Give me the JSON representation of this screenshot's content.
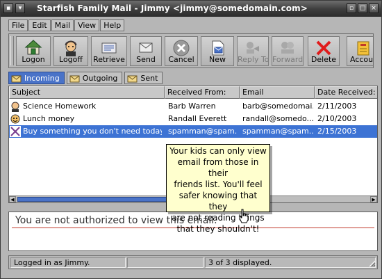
{
  "window": {
    "title": "Starfish Family Mail - Jimmy <jimmy@somedomain.com>"
  },
  "menu": [
    "File",
    "Edit",
    "Mail",
    "View",
    "Help"
  ],
  "toolbar": {
    "buttons": [
      {
        "label": "Logon",
        "icon": "house-icon",
        "enabled": true
      },
      {
        "label": "Logoff",
        "icon": "user-avatar-icon",
        "enabled": true
      },
      {
        "label": "Retrieve",
        "icon": "retrieve-mail-icon",
        "enabled": true
      },
      {
        "label": "Send",
        "icon": "send-mail-icon",
        "enabled": true
      },
      {
        "label": "Cancel",
        "icon": "cancel-icon",
        "enabled": true
      },
      {
        "label": "New",
        "icon": "new-message-icon",
        "enabled": true
      },
      {
        "label": "Reply To",
        "icon": "reply-icon",
        "enabled": false
      },
      {
        "label": "Forward",
        "icon": "forward-icon",
        "enabled": false
      },
      {
        "label": "Delete",
        "icon": "delete-x-icon",
        "enabled": true
      },
      {
        "label": "Accou",
        "icon": "accounts-icon",
        "enabled": true
      }
    ]
  },
  "folders": [
    {
      "label": "Incoming",
      "icon": "incoming-envelope-icon",
      "active": true
    },
    {
      "label": "Outgoing",
      "icon": "outgoing-envelope-icon",
      "active": false
    },
    {
      "label": "Sent",
      "icon": "sent-envelope-icon",
      "active": false
    }
  ],
  "message_list": {
    "columns": [
      "Subject",
      "Received From:",
      "Email",
      "Date Received:"
    ],
    "rows": [
      {
        "icon": "kid-avatar-icon",
        "subject": "Science Homework",
        "from": "Barb Warren",
        "email": "barb@somedomai...",
        "date": "2/11/2003",
        "selected": false
      },
      {
        "icon": "kid-face-icon",
        "subject": "Lunch money",
        "from": "Randall Everett",
        "email": "randall@somedo...",
        "date": "2/10/2003",
        "selected": false
      },
      {
        "icon": "blocked-x-icon",
        "subject": "Buy something you don't need today!",
        "from": "spamman@spam...",
        "email": "spamman@spam...",
        "date": "2/15/2003",
        "selected": true
      }
    ]
  },
  "tooltip": {
    "text_lines": [
      "Your kids can only view",
      "email from those in their",
      "friends list. You'll feel",
      "safer knowing that they",
      "are not reading things",
      "that they shouldn't!"
    ]
  },
  "preview": {
    "message": "You are not authorized to view this email."
  },
  "status": {
    "user": "Logged in as Jimmy.",
    "count": "3 of 3 displayed."
  },
  "colors": {
    "selection": "#3d73d4",
    "tooltip_bg": "#ffffce",
    "titlebar": "#3e3e3e"
  }
}
